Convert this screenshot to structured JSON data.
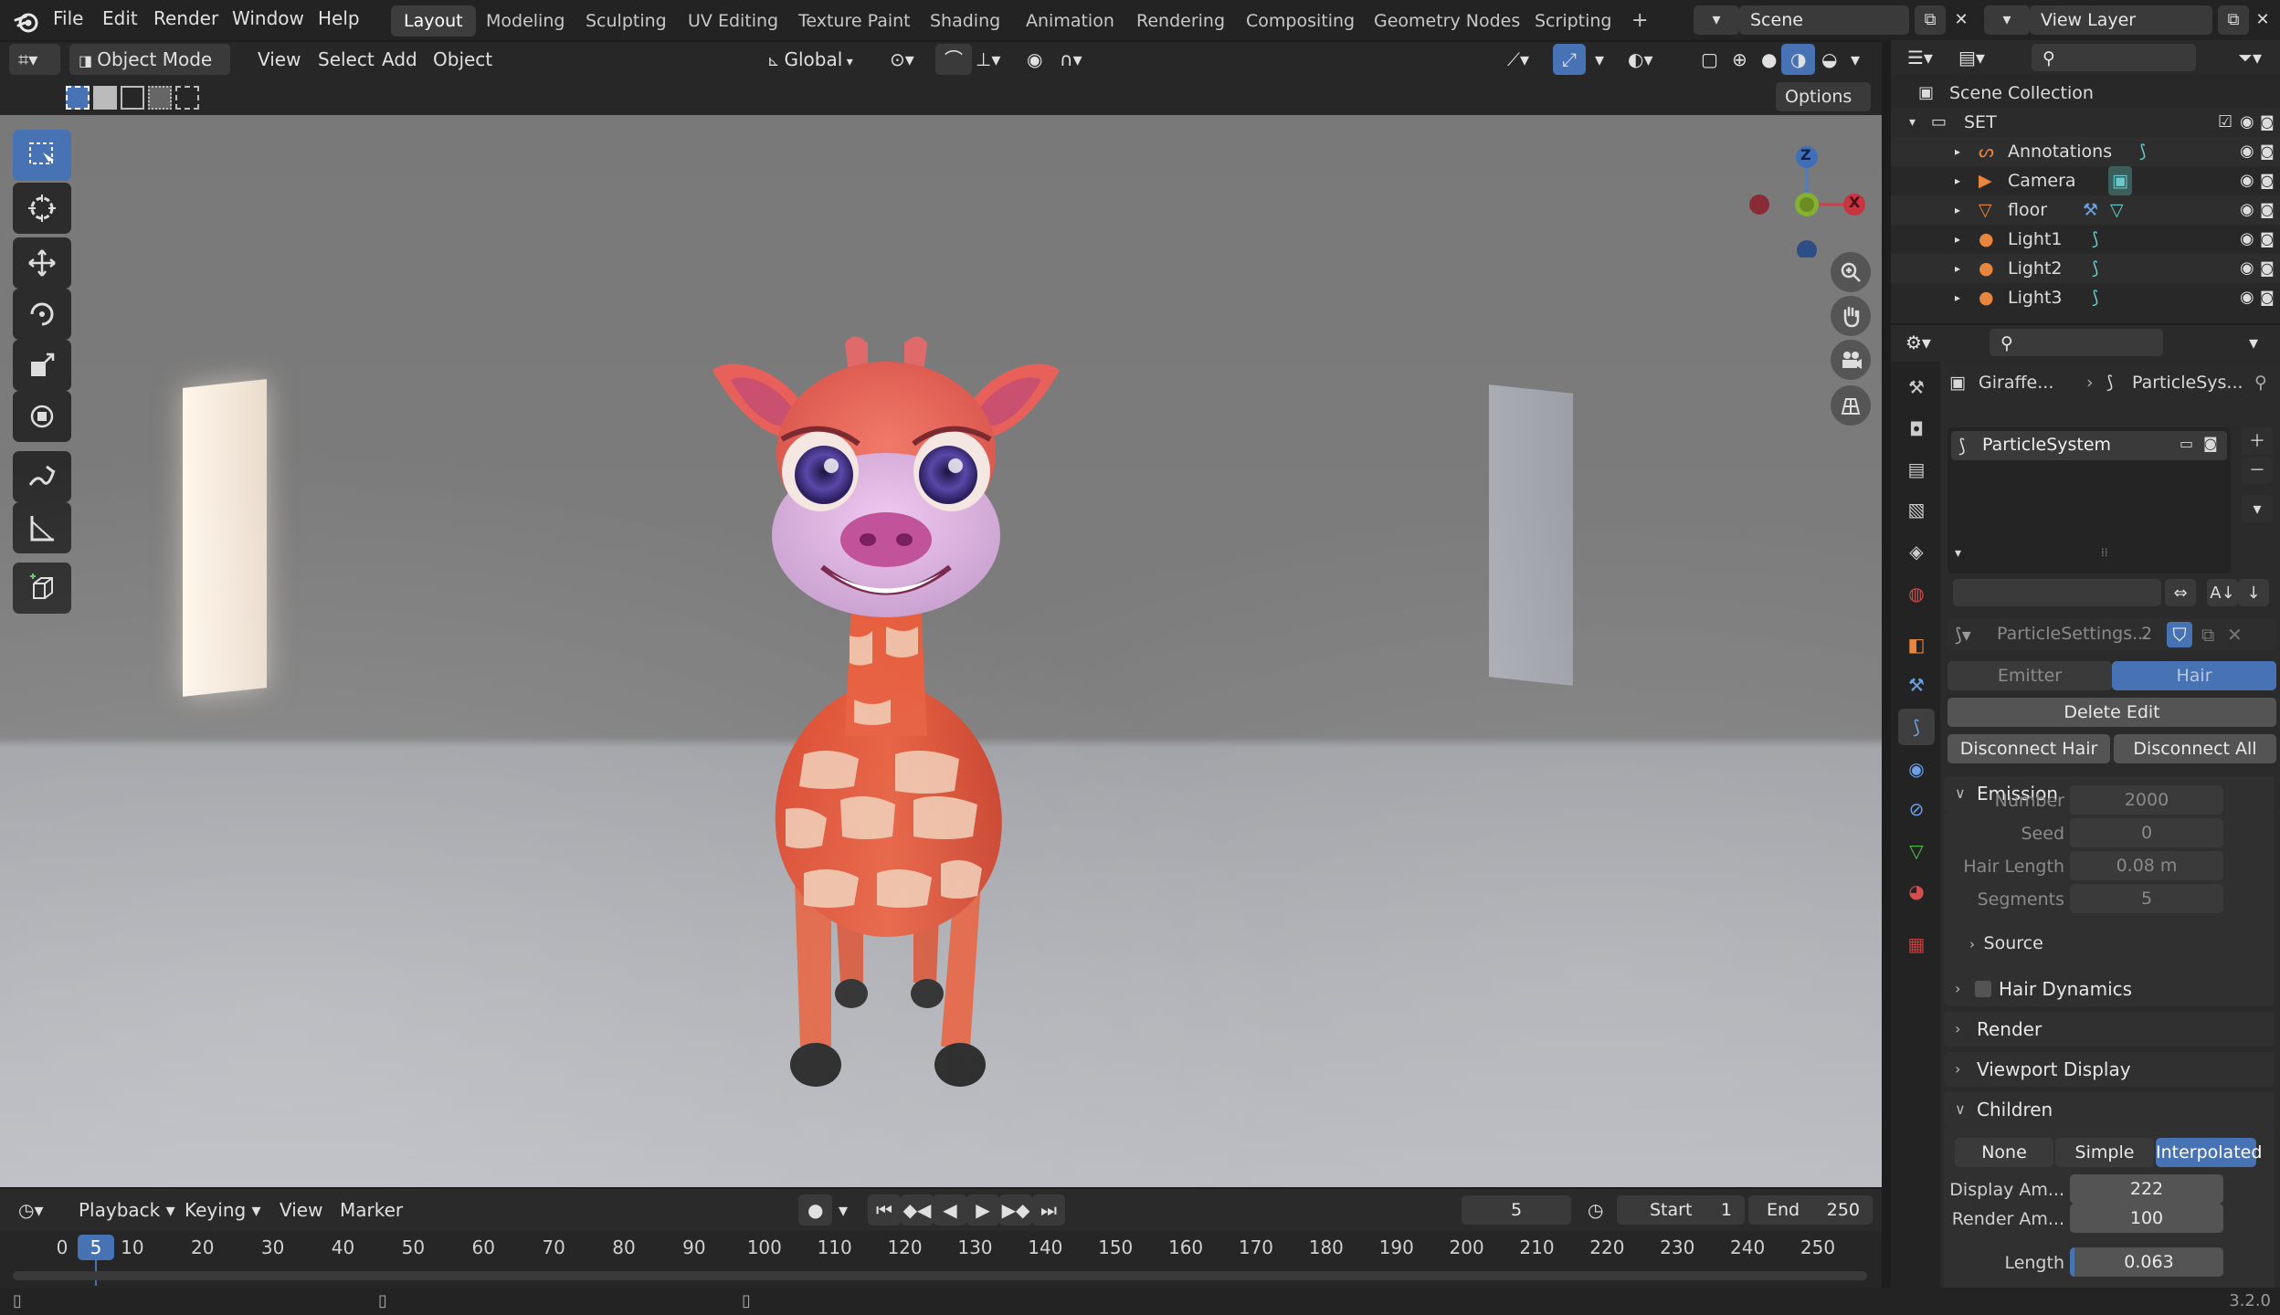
{
  "menu": {
    "file": "File",
    "edit": "Edit",
    "render": "Render",
    "window": "Window",
    "help": "Help"
  },
  "workspaces": [
    "Layout",
    "Modeling",
    "Sculpting",
    "UV Editing",
    "Texture Paint",
    "Shading",
    "Animation",
    "Rendering",
    "Compositing",
    "Geometry Nodes",
    "Scripting",
    "+"
  ],
  "scene": "Scene",
  "view_layer": "View Layer",
  "viewport": {
    "mode": "Object Mode",
    "view": "View",
    "select": "Select",
    "add": "Add",
    "object": "Object",
    "orientation": "Global",
    "options": "Options",
    "gizmo": {
      "x": "X",
      "y": "Y",
      "z": "Z"
    }
  },
  "outliner": {
    "root": "Scene Collection",
    "collection": "SET",
    "items": [
      "Annotations",
      "Camera",
      "floor",
      "Light1",
      "Light2",
      "Light3"
    ]
  },
  "properties": {
    "breadcrumb_object": "Giraffe...",
    "breadcrumb_psys": "ParticleSys...",
    "system_name": "ParticleSystem",
    "settings_name": "ParticleSettings...",
    "settings_users": "2",
    "type_emitter": "Emitter",
    "type_hair": "Hair",
    "delete_edit": "Delete Edit",
    "disconnect_hair": "Disconnect Hair",
    "disconnect_all": "Disconnect All",
    "emission": {
      "title": "Emission",
      "number_label": "Number",
      "number": "2000",
      "seed_label": "Seed",
      "seed": "0",
      "hair_length_label": "Hair Length",
      "hair_length": "0.08 m",
      "segments_label": "Segments",
      "segments": "5",
      "source": "Source"
    },
    "hair_dynamics": "Hair Dynamics",
    "render": "Render",
    "viewport_display": "Viewport Display",
    "children": {
      "title": "Children",
      "none": "None",
      "simple": "Simple",
      "interpolated": "Interpolated",
      "display_amount_label": "Display Am...",
      "display_amount": "222",
      "render_amount_label": "Render Am...",
      "render_amount": "100",
      "length_label": "Length",
      "length": "0.063"
    }
  },
  "timeline": {
    "playback": "Playback",
    "keying": "Keying",
    "view": "View",
    "marker": "Marker",
    "current_frame": "5",
    "start_label": "Start",
    "start": "1",
    "end_label": "End",
    "end": "250",
    "ticks": [
      "0",
      "10",
      "20",
      "30",
      "40",
      "50",
      "60",
      "70",
      "80",
      "90",
      "100",
      "110",
      "120",
      "130",
      "140",
      "150",
      "160",
      "170",
      "180",
      "190",
      "200",
      "210",
      "220",
      "230",
      "240",
      "250"
    ],
    "playhead": "5"
  },
  "version": "3.2.0",
  "colors": {
    "accent": "#4772b3",
    "active_tab": "#4772b3",
    "hair": "#4772b3"
  }
}
